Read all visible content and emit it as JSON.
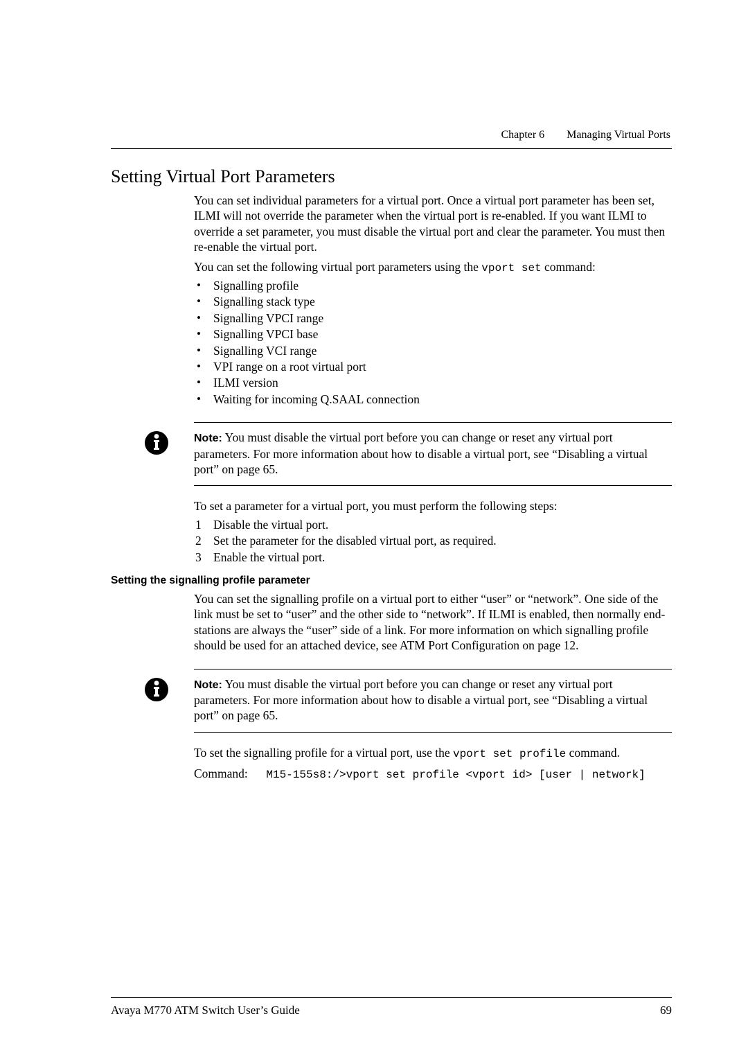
{
  "header": {
    "chapter": "Chapter 6",
    "title": "Managing Virtual Ports"
  },
  "heading": "Setting Virtual Port Parameters",
  "intro1": "You can set individual parameters for a virtual port. Once a virtual port parameter has been set, ILMI will not override the parameter when the virtual port is re-enabled. If you want ILMI to override a set parameter, you must disable the virtual port and clear the parameter. You must then re-enable the virtual port.",
  "intro2_pre": "You can set the following virtual port parameters using the ",
  "intro2_code": "vport set",
  "intro2_post": " command:",
  "bullets": [
    "Signalling profile",
    "Signalling stack type",
    "Signalling VPCI range",
    "Signalling VPCI base",
    "Signalling VCI range",
    "VPI range on a root virtual port",
    "ILMI version",
    "Waiting for incoming Q.SAAL connection"
  ],
  "note1": {
    "label": "Note:",
    "text": " You must disable the virtual port before you can change or reset any virtual port parameters. For more information about how to disable a virtual port, see “Disabling a virtual port” on page 65."
  },
  "steps_intro": "To set a parameter for a virtual port, you must perform the following steps:",
  "steps": [
    "Disable the virtual port.",
    "Set the parameter for the disabled virtual port, as required.",
    "Enable the virtual port."
  ],
  "subheading": "Setting the signalling profile parameter",
  "sub_para": "You can set the signalling profile on a virtual port to either “user” or “network”. One side of the link must be set to “user” and the other side to “network”. If ILMI is enabled, then normally end-stations are always the “user” side of a link. For more information on which signalling profile should be used for an attached device, see ATM Port Configuration on page 12.",
  "note2": {
    "label": "Note:",
    "text": " You must disable the virtual port before you can change or reset any virtual port parameters. For more information about how to disable a virtual port, see “Disabling a virtual port” on page 65."
  },
  "cmd_intro_pre": "To set the signalling profile for a virtual port, use the ",
  "cmd_intro_code": "vport set profile",
  "cmd_intro_post": " command.",
  "cmd_label": "Command:",
  "cmd_text": "M15-155s8:/>vport set profile <vport id> [user | network]",
  "footer": {
    "left": "Avaya M770 ATM Switch User’s Guide",
    "right": "69"
  },
  "icons": {
    "info": "info-icon"
  }
}
